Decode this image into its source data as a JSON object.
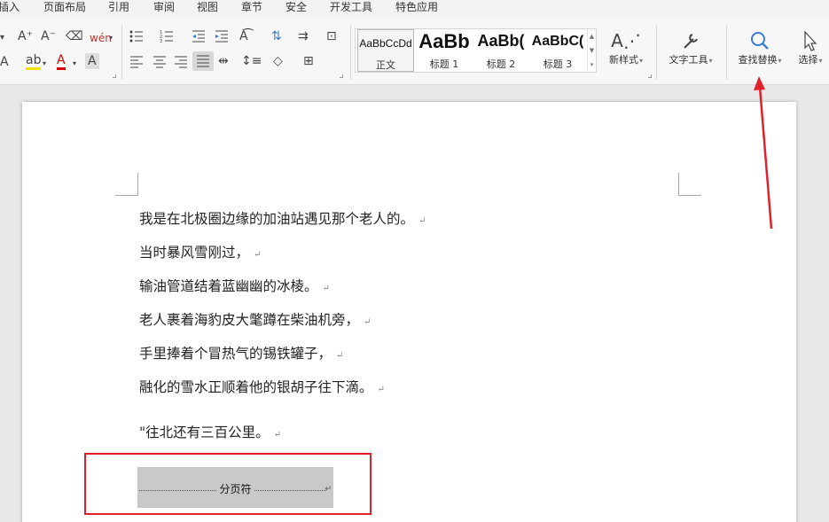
{
  "menu": {
    "items": [
      "插入",
      "页面布局",
      "引用",
      "审阅",
      "视图",
      "章节",
      "安全",
      "开发工具",
      "特色应用"
    ]
  },
  "ribbon": {
    "font_group": {
      "grow_font": "A⁺",
      "shrink_font": "A⁻",
      "clear_format": "⌫",
      "phonetic": "wén",
      "text_effect": "A",
      "highlight": "ab",
      "font_color": "A",
      "char_shading": "A"
    },
    "styles": [
      {
        "sample": "AaBbCcDd",
        "name": "正文"
      },
      {
        "sample": "AaBb",
        "name": "标题 1"
      },
      {
        "sample": "AaBb(",
        "name": "标题 2"
      },
      {
        "sample": "AaBbC(",
        "name": "标题 3"
      }
    ],
    "new_style": {
      "icon": "A⋰",
      "label": "新样式"
    },
    "text_tools": {
      "icon": "🔧",
      "label": "文字工具"
    },
    "find_replace": {
      "icon": "🔍",
      "label": "查找替换"
    },
    "select": {
      "icon": "⬉",
      "label": "选择"
    }
  },
  "document": {
    "paragraphs": [
      "我是在北极圈边缘的加油站遇见那个老人的。",
      "当时暴风雪刚过，",
      "输油管道结着蓝幽幽的冰棱。",
      "老人裹着海豹皮大氅蹲在柴油机旁，",
      "手里捧着个冒热气的锡铁罐子，",
      "融化的雪水正顺着他的银胡子往下滴。",
      "\"往北还有三百公里。"
    ],
    "paragraph_mark": "↵",
    "page_break_label": "分页符"
  },
  "colors": {
    "annotation_red": "#e0202a",
    "page_break_bg": "#c9c9c9"
  }
}
